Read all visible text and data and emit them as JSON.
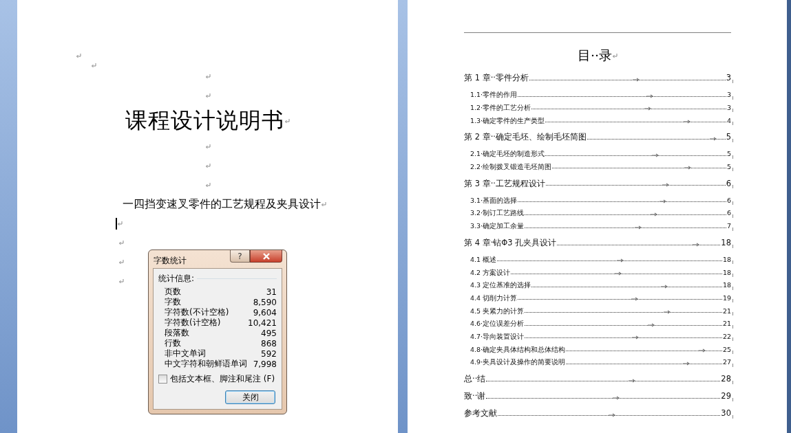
{
  "cover_page": {
    "paragraphs": [
      {
        "kind": "empty"
      },
      {
        "kind": "empty"
      },
      {
        "kind": "title",
        "text": "课程设计说明书"
      },
      {
        "kind": "empty"
      },
      {
        "kind": "empty"
      },
      {
        "kind": "empty"
      },
      {
        "kind": "subtitle",
        "text": "一四挡变速叉零件的工艺规程及夹具设计"
      },
      {
        "kind": "caret"
      },
      {
        "kind": "empty_left"
      },
      {
        "kind": "empty_left"
      },
      {
        "kind": "empty_left"
      }
    ]
  },
  "word_count_dialog": {
    "title": "字数统计",
    "help_button": "?",
    "group_label": "统计信息:",
    "stats": [
      {
        "label": "页数",
        "value": "31"
      },
      {
        "label": "字数",
        "value": "8,590"
      },
      {
        "label": "字符数(不计空格)",
        "value": "9,604"
      },
      {
        "label": "字符数(计空格)",
        "value": "10,421"
      },
      {
        "label": "段落数",
        "value": "495"
      },
      {
        "label": "行数",
        "value": "868"
      },
      {
        "label": "非中文单词",
        "value": "592"
      },
      {
        "label": "中文字符和朝鲜语单词",
        "value": "7,998"
      }
    ],
    "checkbox": {
      "label": "包括文本框、脚注和尾注 (F)",
      "checked": false
    },
    "close_button": "关闭"
  },
  "toc_page": {
    "title": "目··录",
    "entries": [
      {
        "kind": "chapter",
        "text": "第 1 章··零件分析",
        "page": "3"
      },
      {
        "kind": "section",
        "text": "1.1·零件的作用",
        "page": "3"
      },
      {
        "kind": "section",
        "text": "1.2·零件的工艺分析",
        "page": "3"
      },
      {
        "kind": "section",
        "text": "1.3·确定零件的生产类型",
        "page": "4"
      },
      {
        "kind": "chapter",
        "text": "第 2 章··确定毛坯、绘制毛坯简图",
        "page": "5"
      },
      {
        "kind": "section",
        "text": "2.1·确定毛坯的制造形式",
        "page": "5"
      },
      {
        "kind": "section",
        "text": "2.2·绘制拨叉锻造毛坯简图",
        "page": "5"
      },
      {
        "kind": "chapter",
        "text": "第 3 章··工艺规程设计",
        "page": "6"
      },
      {
        "kind": "section",
        "text": "3.1·基面的选择",
        "page": "6"
      },
      {
        "kind": "section",
        "text": "3.2·制订工艺路线",
        "page": "6"
      },
      {
        "kind": "section",
        "text": "3.3·确定加工余量",
        "page": "7"
      },
      {
        "kind": "chapter",
        "text": "第 4 章·钻Φ3 孔夹具设计",
        "page": "18"
      },
      {
        "kind": "section",
        "text": "4.1 概述",
        "page": "18"
      },
      {
        "kind": "section",
        "text": "4.2 方案设计",
        "page": "18"
      },
      {
        "kind": "section",
        "text": "4.3 定位基准的选择",
        "page": "18"
      },
      {
        "kind": "section",
        "text": "4.4 切削力计算",
        "page": "19"
      },
      {
        "kind": "section",
        "text": "4.5 夹紧力的计算",
        "page": "21"
      },
      {
        "kind": "section",
        "text": "4.6·定位误差分析",
        "page": "21"
      },
      {
        "kind": "section",
        "text": "4.7·导向装置设计",
        "page": "22"
      },
      {
        "kind": "section",
        "text": "4.8·确定夹具体结构和总体结构",
        "page": "25"
      },
      {
        "kind": "section",
        "text": "4.9·夹具设计及操作的简要说明",
        "page": "27"
      },
      {
        "kind": "chapter",
        "text": "总··结",
        "page": "28"
      },
      {
        "kind": "chapter",
        "text": "致··谢",
        "page": "29"
      },
      {
        "kind": "chapter",
        "text": "参考文献",
        "page": "30"
      }
    ]
  }
}
